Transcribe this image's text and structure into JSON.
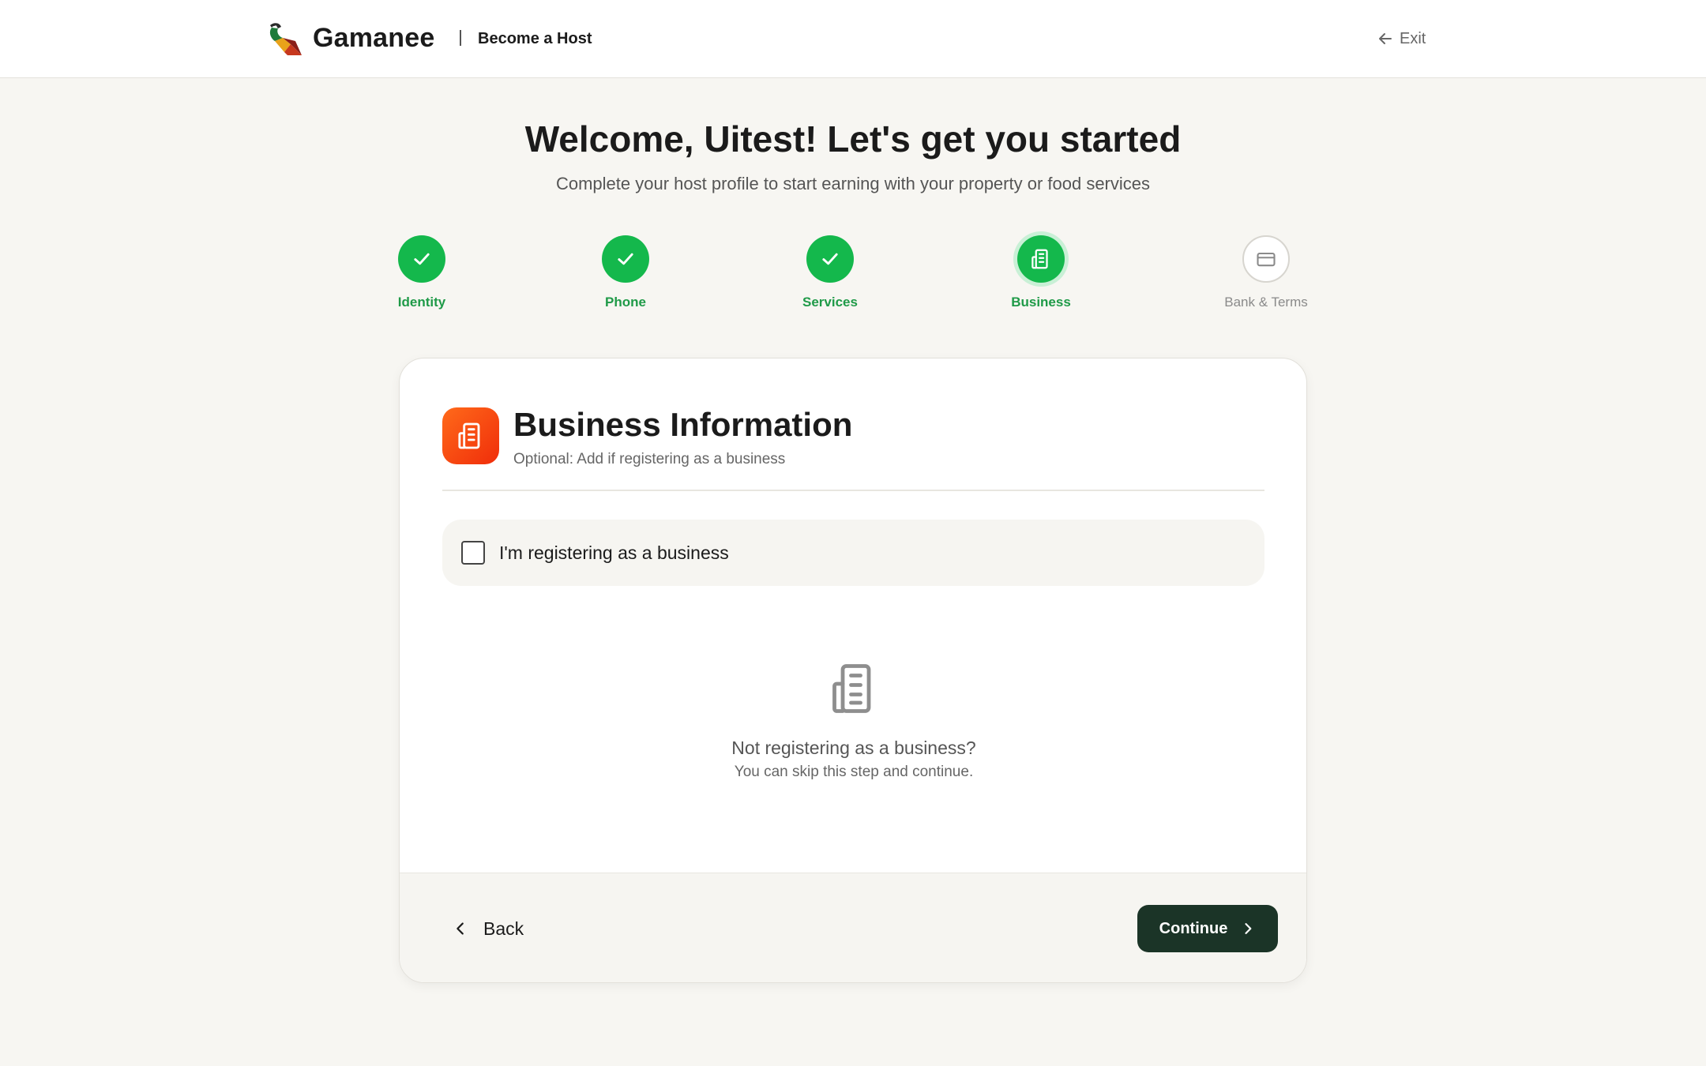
{
  "header": {
    "brand": "Gamanee",
    "section": "Become a Host",
    "exit_label": "Exit"
  },
  "welcome": {
    "title": "Welcome, Uitest! Let's get you started",
    "subtitle": "Complete your host profile to start earning with your property or food services"
  },
  "stepper": {
    "steps": [
      {
        "label": "Identity",
        "status": "done"
      },
      {
        "label": "Phone",
        "status": "done"
      },
      {
        "label": "Services",
        "status": "done"
      },
      {
        "label": "Business",
        "status": "current"
      },
      {
        "label": "Bank & Terms",
        "status": "pending"
      }
    ]
  },
  "card": {
    "title": "Business Information",
    "subtitle": "Optional: Add if registering as a business",
    "checkbox_label": "I'm registering as a business",
    "checkbox_checked": false,
    "empty_title": "Not registering as a business?",
    "empty_subtitle": "You can skip this step and continue."
  },
  "footer": {
    "back_label": "Back",
    "continue_label": "Continue"
  },
  "colors": {
    "accent_green": "#14b84c",
    "primary_button": "#1b3427",
    "business_icon": "#f02d0a"
  }
}
